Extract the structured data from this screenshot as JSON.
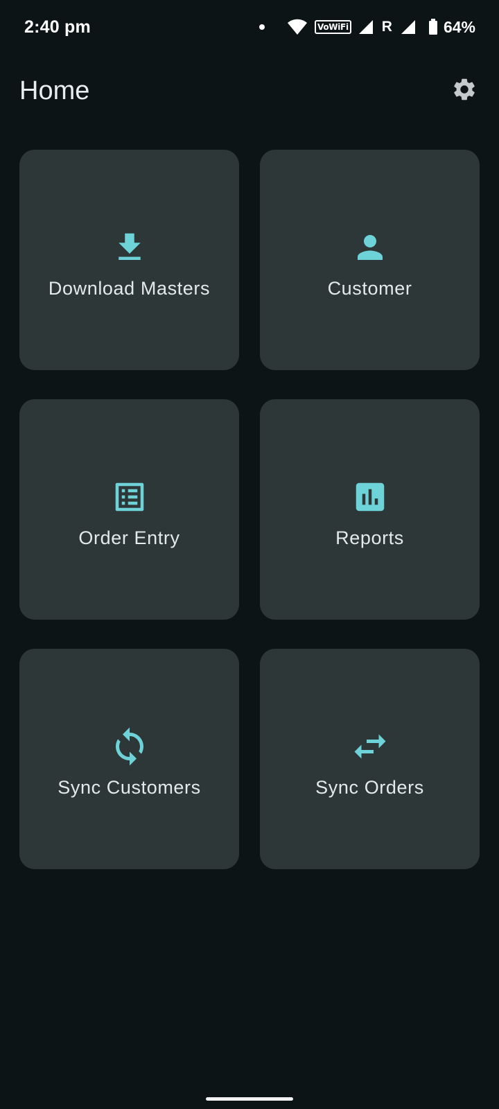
{
  "status_bar": {
    "time": "2:40 pm",
    "vowifi": "VoWiFi",
    "roaming": "R",
    "battery": "64%"
  },
  "app_bar": {
    "title": "Home",
    "settings_icon": "gear-icon"
  },
  "tiles": [
    {
      "label": "Download Masters",
      "icon": "download-icon"
    },
    {
      "label": "Customer",
      "icon": "person-icon"
    },
    {
      "label": "Order Entry",
      "icon": "list-icon"
    },
    {
      "label": "Reports",
      "icon": "bar-chart-icon"
    },
    {
      "label": "Sync Customers",
      "icon": "sync-icon"
    },
    {
      "label": "Sync Orders",
      "icon": "swap-arrows-icon"
    }
  ],
  "colors": {
    "background": "#0c1416",
    "tile": "#2e3737",
    "accent": "#6dd3d9",
    "text": "#e4eaeb",
    "settings_icon": "#c4cacb"
  }
}
